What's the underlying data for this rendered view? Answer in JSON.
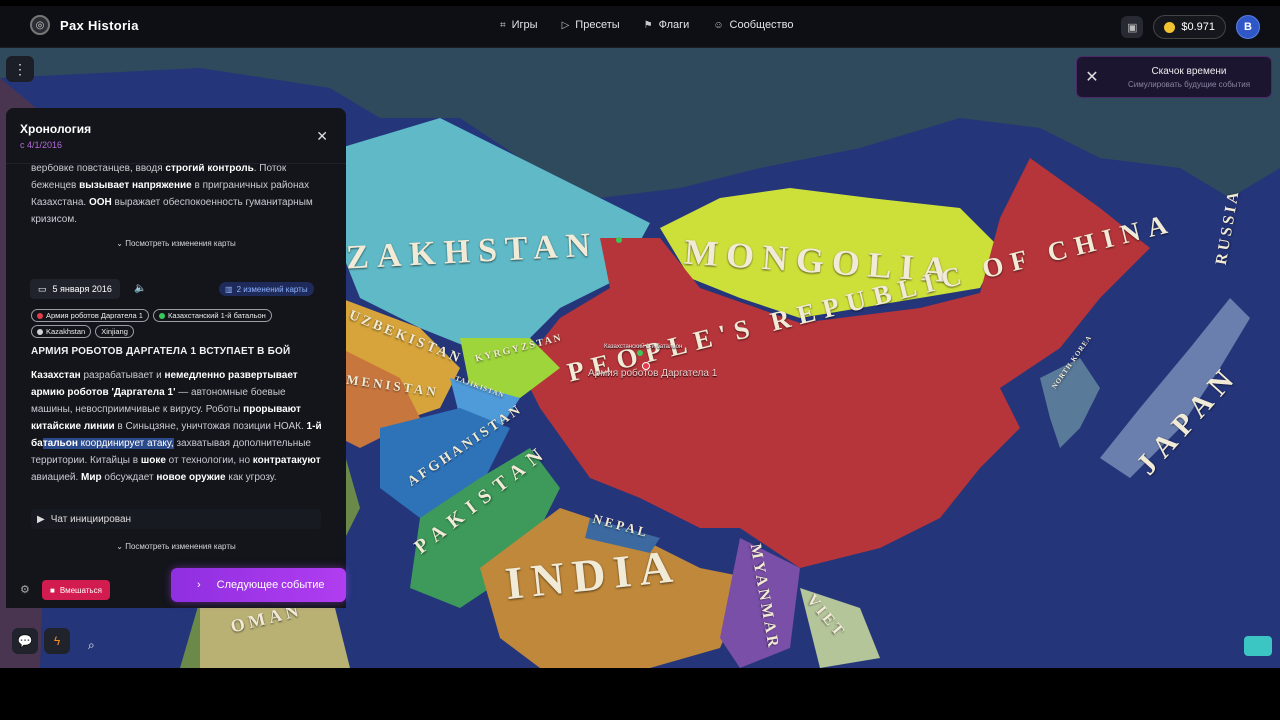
{
  "app": {
    "brand": "Pax Historia"
  },
  "nav": {
    "items": [
      {
        "label": "Игры",
        "icon": "gamepad-icon"
      },
      {
        "label": "Пресеты",
        "icon": "play-icon"
      },
      {
        "label": "Флаги",
        "icon": "flag-icon"
      },
      {
        "label": "Сообщество",
        "icon": "users-icon"
      }
    ]
  },
  "account": {
    "balance": "$0.971",
    "avatar_letter": "B"
  },
  "toast": {
    "title": "Скачок времени",
    "subtitle": "Симулировать будущие события"
  },
  "timeline": {
    "title": "Хронология",
    "since": "с 4/1/2016",
    "see_changes": "Посмотреть изменения карты",
    "event": {
      "date": "5 января 2016",
      "changes_count": "2 изменений карты",
      "tags": [
        {
          "label": "Армия роботов Даргатела 1",
          "color": "#e23b4a"
        },
        {
          "label": "Казахстанский 1-й батальон",
          "color": "#38c95a"
        },
        {
          "label": "Kazakhstan",
          "color": "#cfd2d8"
        },
        {
          "label": "Xinjiang",
          "color": ""
        }
      ],
      "title": "АРМИЯ РОБОТОВ ДАРГАТЕЛА 1 ВСТУПАЕТ В БОЙ",
      "chat_label": "Чат инициирован"
    }
  },
  "actions": {
    "intervene": "Вмешаться",
    "next_event": "Следующее событие"
  },
  "map": {
    "labels": {
      "kazakhstan": "ZAKHSTAN",
      "mongolia": "MONGOLIA",
      "china": "PEOPLE'S REPUBLIC OF CHINA",
      "india": "INDIA",
      "pakistan": "PAKISTAN",
      "afghanistan": "AFGHANISTAN",
      "uzbekistan": "UZBEKISTAN",
      "kyrgyzstan": "KYRGYZSTAN",
      "tajikistan": "TAJIKISTAN",
      "turkmenistan": "MENISTAN",
      "nepal": "NEPAL",
      "japan": "JAPAN",
      "russia": "RUSSIA",
      "north_korea": "NORTH KOREA",
      "myanmar": "MYANMAR",
      "vietnam": "VIET",
      "oman": "OMAN"
    },
    "unit_labels": {
      "robot_army": "Армия роботов Даргатела 1",
      "kz_battalion": "Казахстанский 1-й батальон"
    }
  }
}
